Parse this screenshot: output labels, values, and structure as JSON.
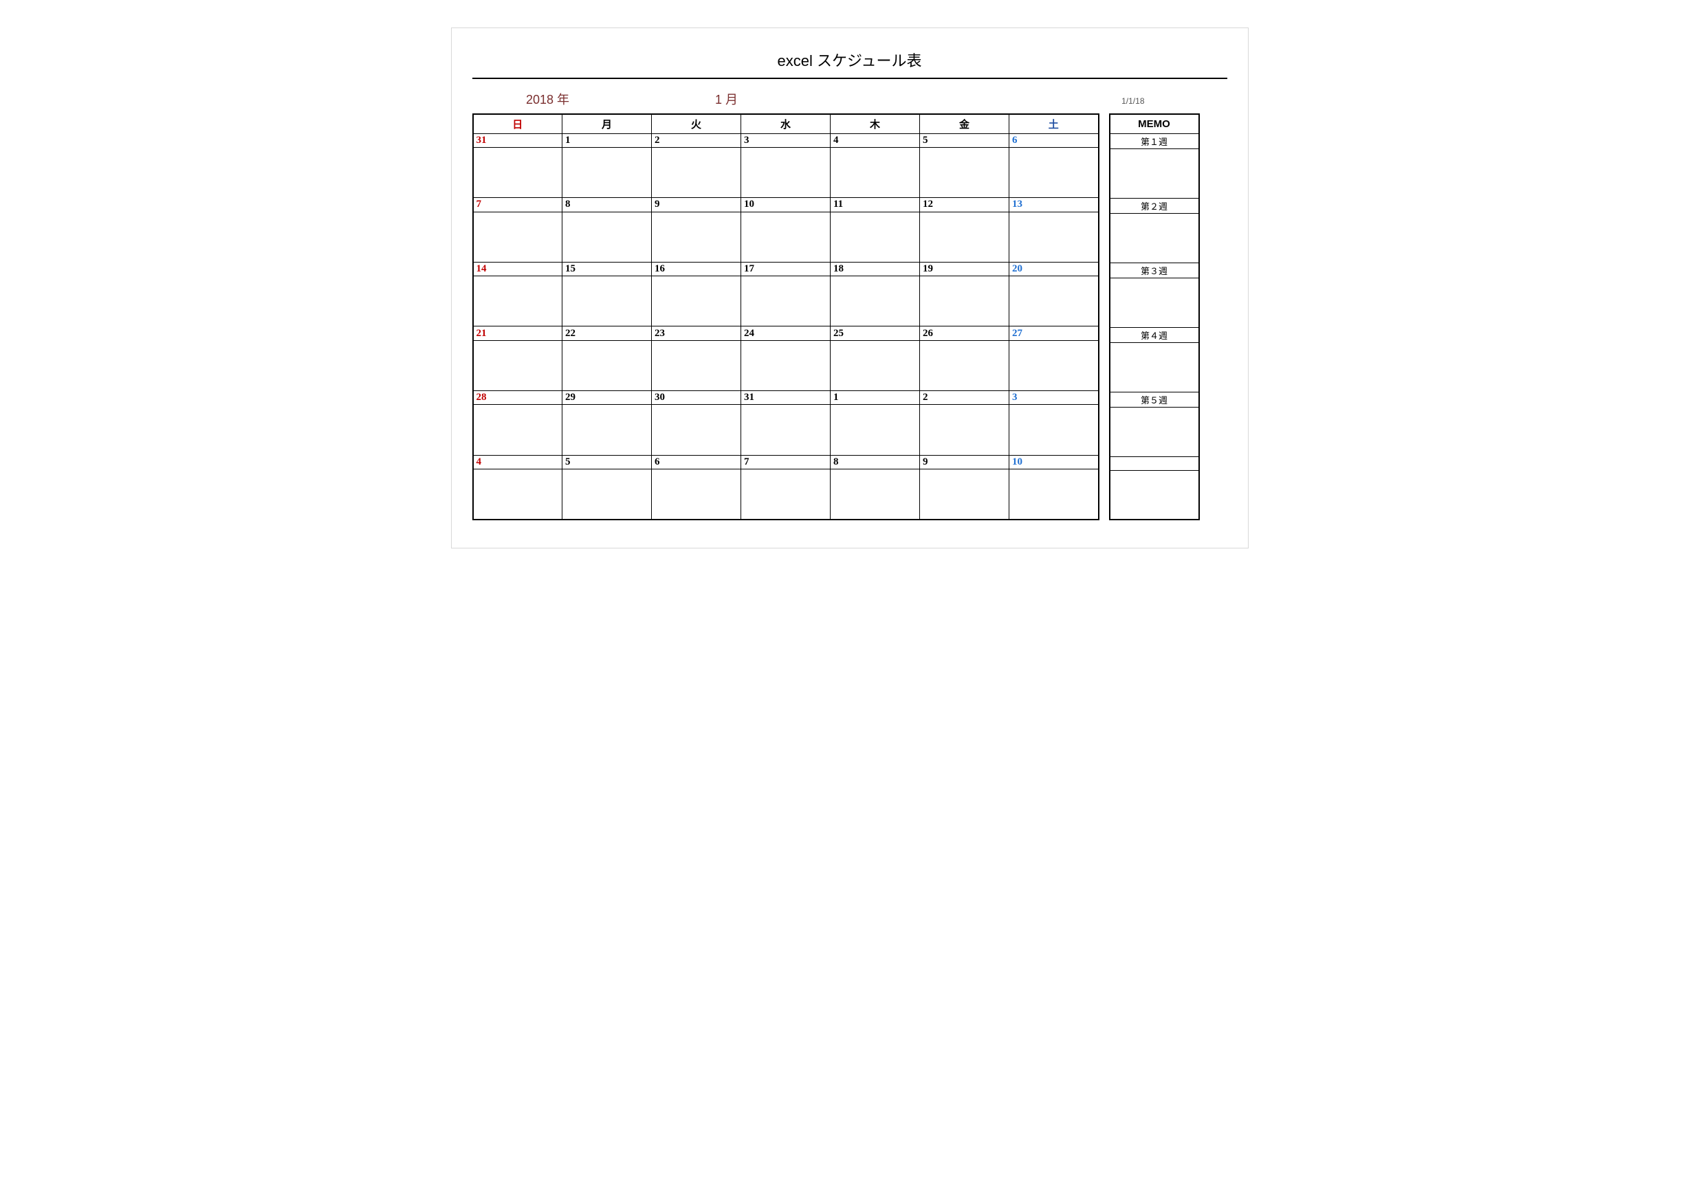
{
  "title": "excel スケジュール表",
  "year": "2018 年",
  "month": "1 月",
  "start_date": "1/1/18",
  "day_headers": [
    "日",
    "月",
    "火",
    "水",
    "木",
    "金",
    "土"
  ],
  "memo_header": "MEMO",
  "weeks": [
    {
      "label": "第１週",
      "days": [
        "31",
        "1",
        "2",
        "3",
        "4",
        "5",
        "6"
      ]
    },
    {
      "label": "第２週",
      "days": [
        "7",
        "8",
        "9",
        "10",
        "11",
        "12",
        "13"
      ]
    },
    {
      "label": "第３週",
      "days": [
        "14",
        "15",
        "16",
        "17",
        "18",
        "19",
        "20"
      ]
    },
    {
      "label": "第４週",
      "days": [
        "21",
        "22",
        "23",
        "24",
        "25",
        "26",
        "27"
      ]
    },
    {
      "label": "第５週",
      "days": [
        "28",
        "29",
        "30",
        "31",
        "1",
        "2",
        "3"
      ]
    },
    {
      "label": "",
      "days": [
        "4",
        "5",
        "6",
        "7",
        "8",
        "9",
        "10"
      ]
    }
  ]
}
